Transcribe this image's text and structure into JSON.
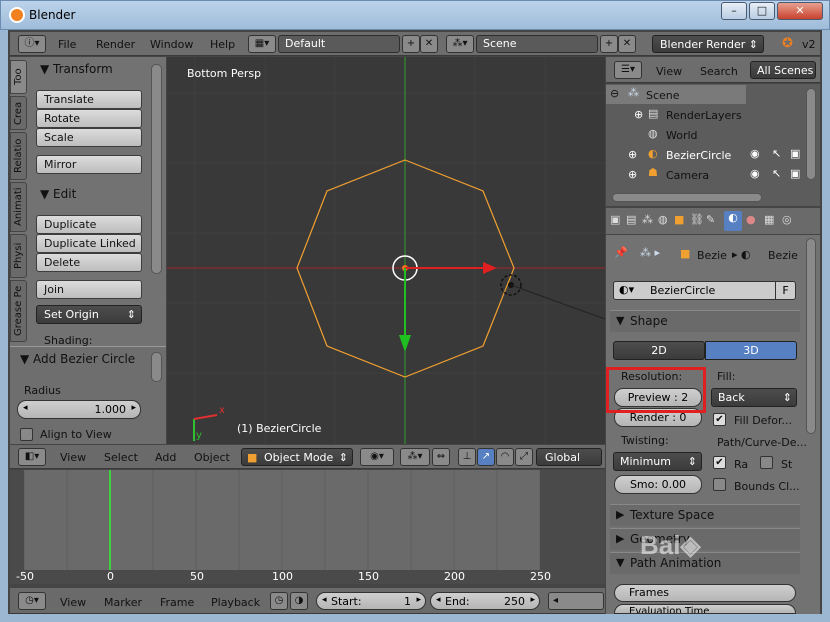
{
  "window": {
    "title": "Blender",
    "min": "–",
    "max": "□",
    "close": "✕"
  },
  "top_menu": {
    "items": [
      "File",
      "Render",
      "Window",
      "Help"
    ],
    "layout": "Default",
    "scene": "Scene",
    "engine": "Blender Render",
    "version": "v2"
  },
  "toolshelf": {
    "tabs": [
      "Too",
      "Crea",
      "Relatio",
      "Animati",
      "Physi",
      "Grease Pe"
    ],
    "transform_header": "Transform",
    "transform_buttons": [
      "Translate",
      "Rotate",
      "Scale"
    ],
    "mirror": "Mirror",
    "edit_header": "Edit",
    "edit_buttons": [
      "Duplicate",
      "Duplicate Linked",
      "Delete"
    ],
    "join": "Join",
    "set_origin": "Set Origin",
    "shading": "Shading:",
    "operator_header": "Add Bezier Circle",
    "radius_label": "Radius",
    "radius_value": "1.000",
    "align_label": "Align to View"
  },
  "viewport": {
    "view_label": "Bottom Persp",
    "object_label": "(1) BezierCircle",
    "axis_x": "x",
    "axis_y": "y"
  },
  "viewport_header": {
    "menus": [
      "View",
      "Select",
      "Add",
      "Object"
    ],
    "mode": "Object Mode",
    "orientation": "Global"
  },
  "outliner": {
    "menus": [
      "View",
      "Search"
    ],
    "filter": "All Scenes",
    "rows": [
      "Scene",
      "RenderLayers",
      "World",
      "BezierCircle",
      "Camera"
    ]
  },
  "properties": {
    "breadcrumb": [
      "Bezie",
      "Bezie"
    ],
    "object_name": "BezierCircle",
    "fake_user": "F",
    "shape_header": "Shape",
    "dim_2d": "2D",
    "dim_3d": "3D",
    "resolution_label": "Resolution:",
    "preview": "Preview : 2",
    "render": "Render :  0",
    "fill_label": "Fill:",
    "fill_value": "Back",
    "fill_deform": "Fill Defor...",
    "twisting_label": "Twisting:",
    "twisting_value": "Minimum",
    "smooth": "Smo:  0.00",
    "path_label": "Path/Curve-De...",
    "radius_chk": "Ra",
    "stretch_chk": "St",
    "bounds_chk": "Bounds Cl...",
    "texture_space": "Texture Space",
    "geometry": "Geometry",
    "path_animation": "Path Animation",
    "frames": "Frames",
    "eval_time": "Evaluation Time"
  },
  "timeline": {
    "ticks": [
      "-50",
      "0",
      "50",
      "100",
      "150",
      "200",
      "250"
    ],
    "menus": [
      "View",
      "Marker",
      "Frame",
      "Playback"
    ],
    "start_label": "Start:",
    "start_value": "1",
    "end_label": "End:",
    "end_value": "250"
  },
  "colors": {
    "accent": "#5680c2",
    "highlight": "#e02020",
    "curve": "#f0a030"
  }
}
